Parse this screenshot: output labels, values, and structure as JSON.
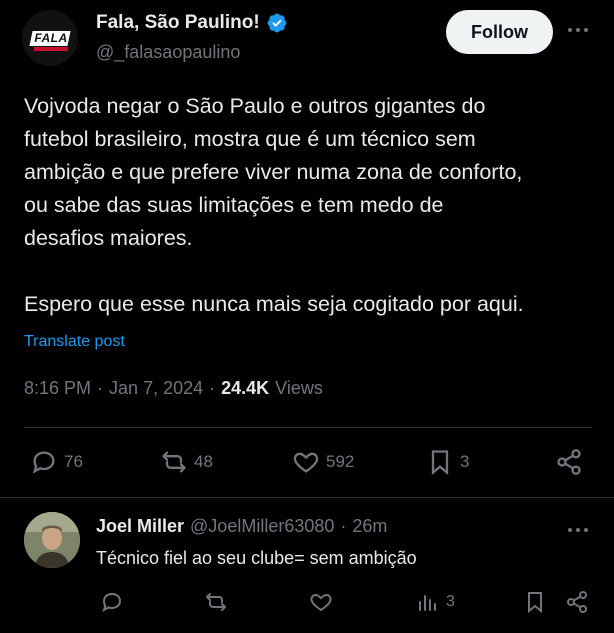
{
  "post": {
    "author_name": "Fala, São Paulino!",
    "author_handle": "@_falasaopaulino",
    "avatar_logo_text": "FALA",
    "follow_label": "Follow",
    "text": "Vojvoda negar o São Paulo e outros gigantes do\nfutebol brasileiro, mostra que é um técnico sem\nambição e que prefere viver numa zona de conforto,\nou sabe das suas limitações e tem medo de\ndesafios maiores.\n\nEspero que esse nunca mais seja cogitado por aqui.",
    "translate_label": "Translate post",
    "time": "8:16 PM",
    "date": "Jan 7, 2024",
    "views_count": "24.4K",
    "views_label": "Views",
    "replies": "76",
    "reposts": "48",
    "likes": "592",
    "bookmarks": "3"
  },
  "reply": {
    "author_name": "Joel Miller",
    "author_handle": "@JoelMiller63080",
    "time": "26m",
    "text": "Técnico fiel ao seu clube= sem ambição",
    "views": "3"
  },
  "colors": {
    "background": "#000000",
    "text": "#e7e9ea",
    "muted": "#71767b",
    "accent": "#1d9bf0",
    "verified": "#1d9bf0"
  },
  "icons": [
    "verified-badge-icon",
    "more-icon",
    "reply-icon",
    "repost-icon",
    "like-icon",
    "bookmark-icon",
    "share-icon",
    "views-icon"
  ]
}
